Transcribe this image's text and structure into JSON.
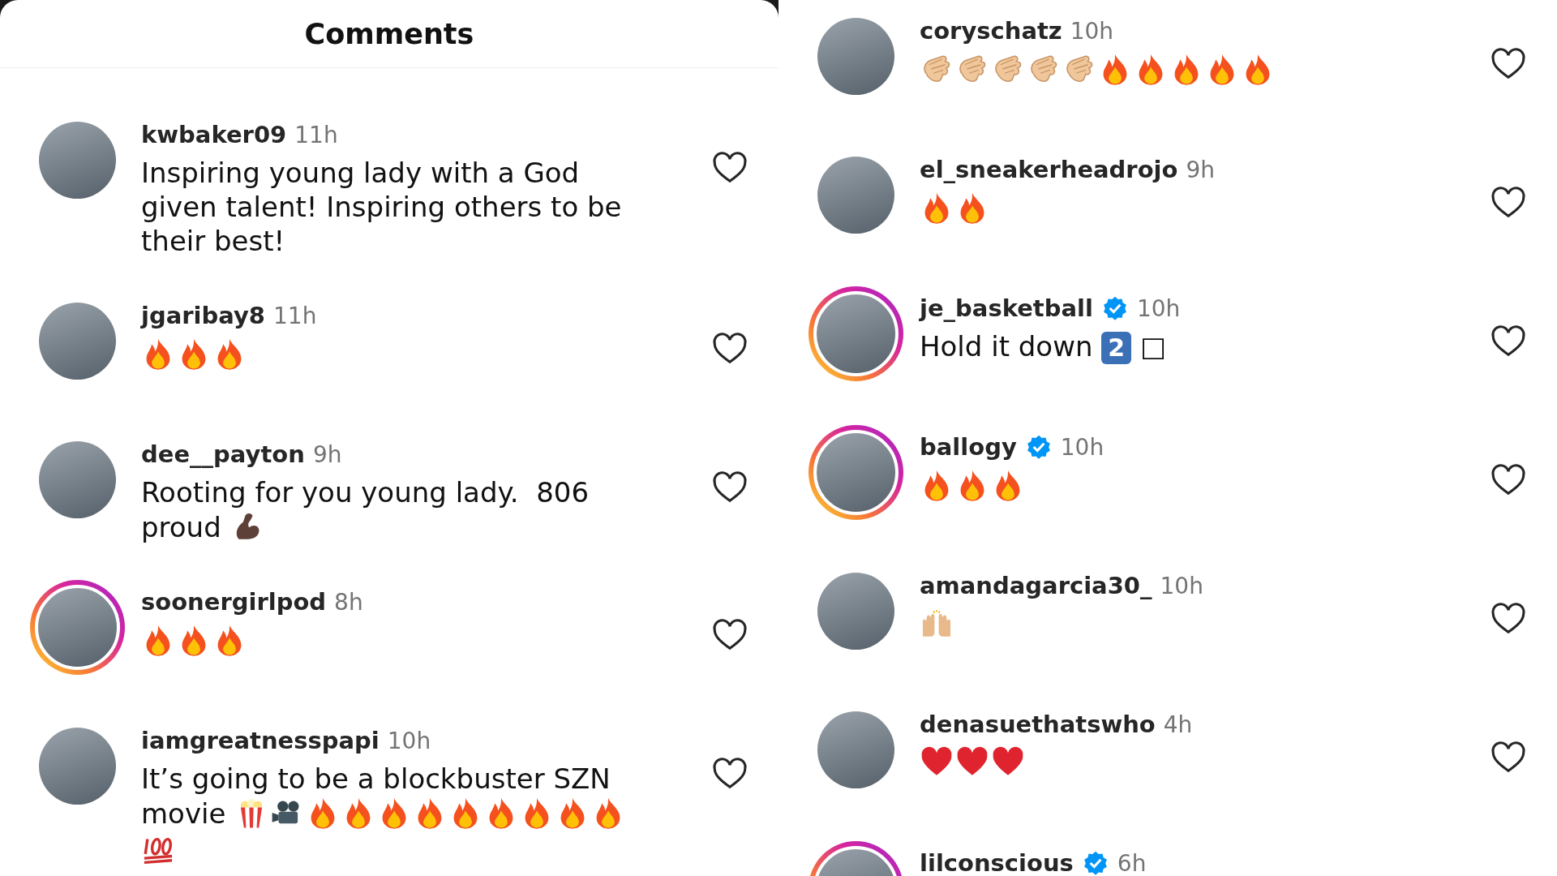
{
  "left_panel": {
    "title": "Comments",
    "comments": [
      {
        "username": "kwbaker09",
        "time": "11h",
        "verified": false,
        "story_ring": false,
        "parts": [
          {
            "kind": "text",
            "text": "Inspiring young lady with a God given talent! Inspiring others to be their best!"
          }
        ]
      },
      {
        "username": "jgaribay8",
        "time": "11h",
        "verified": false,
        "story_ring": false,
        "parts": [
          {
            "kind": "fire"
          },
          {
            "kind": "fire"
          },
          {
            "kind": "fire"
          }
        ]
      },
      {
        "username": "dee__payton",
        "time": "9h",
        "verified": false,
        "story_ring": false,
        "parts": [
          {
            "kind": "text",
            "text": "Rooting for you young lady.  806"
          },
          {
            "kind": "break"
          },
          {
            "kind": "text",
            "text": "proud "
          },
          {
            "kind": "muscle"
          }
        ]
      },
      {
        "username": "soonergirlpod",
        "time": "8h",
        "verified": false,
        "story_ring": true,
        "parts": [
          {
            "kind": "fire"
          },
          {
            "kind": "fire"
          },
          {
            "kind": "fire"
          }
        ]
      },
      {
        "username": "iamgreatnesspapi",
        "time": "10h",
        "verified": false,
        "story_ring": false,
        "parts": [
          {
            "kind": "text",
            "text": "It’s going to be a blockbuster SZN"
          },
          {
            "kind": "break"
          },
          {
            "kind": "text",
            "text": "movie "
          },
          {
            "kind": "popcorn"
          },
          {
            "kind": "camera"
          },
          {
            "kind": "fire"
          },
          {
            "kind": "fire"
          },
          {
            "kind": "fire"
          },
          {
            "kind": "fire"
          },
          {
            "kind": "fire"
          },
          {
            "kind": "fire"
          },
          {
            "kind": "fire"
          },
          {
            "kind": "fire"
          },
          {
            "kind": "fire"
          },
          {
            "kind": "break"
          },
          {
            "kind": "hundred"
          }
        ]
      }
    ]
  },
  "right_panel": {
    "comments": [
      {
        "username": "coryschatz",
        "time": "10h",
        "verified": false,
        "story_ring": false,
        "parts": [
          {
            "kind": "clap"
          },
          {
            "kind": "clap"
          },
          {
            "kind": "clap"
          },
          {
            "kind": "clap"
          },
          {
            "kind": "clap"
          },
          {
            "kind": "fire"
          },
          {
            "kind": "fire"
          },
          {
            "kind": "fire"
          },
          {
            "kind": "fire"
          },
          {
            "kind": "fire"
          }
        ]
      },
      {
        "username": "el_sneakerheadrojo",
        "time": "9h",
        "verified": false,
        "story_ring": false,
        "parts": [
          {
            "kind": "fire"
          },
          {
            "kind": "fire"
          }
        ]
      },
      {
        "username": "je_basketball",
        "time": "10h",
        "verified": true,
        "story_ring": true,
        "parts": [
          {
            "kind": "text",
            "text": "Hold it down "
          },
          {
            "kind": "keycap",
            "text": "2"
          },
          {
            "kind": "text",
            "text": " □"
          }
        ]
      },
      {
        "username": "ballogy",
        "time": "10h",
        "verified": true,
        "story_ring": true,
        "parts": [
          {
            "kind": "fire"
          },
          {
            "kind": "fire"
          },
          {
            "kind": "fire"
          }
        ]
      },
      {
        "username": "amandagarcia30_",
        "time": "10h",
        "verified": false,
        "story_ring": false,
        "parts": [
          {
            "kind": "raised_hands"
          }
        ]
      },
      {
        "username": "denasuethatswho",
        "time": "4h",
        "verified": false,
        "story_ring": false,
        "parts": [
          {
            "kind": "heart"
          },
          {
            "kind": "heart"
          },
          {
            "kind": "heart"
          }
        ]
      },
      {
        "username": "lilconscious",
        "time": "6h",
        "verified": true,
        "story_ring": true
      }
    ]
  }
}
